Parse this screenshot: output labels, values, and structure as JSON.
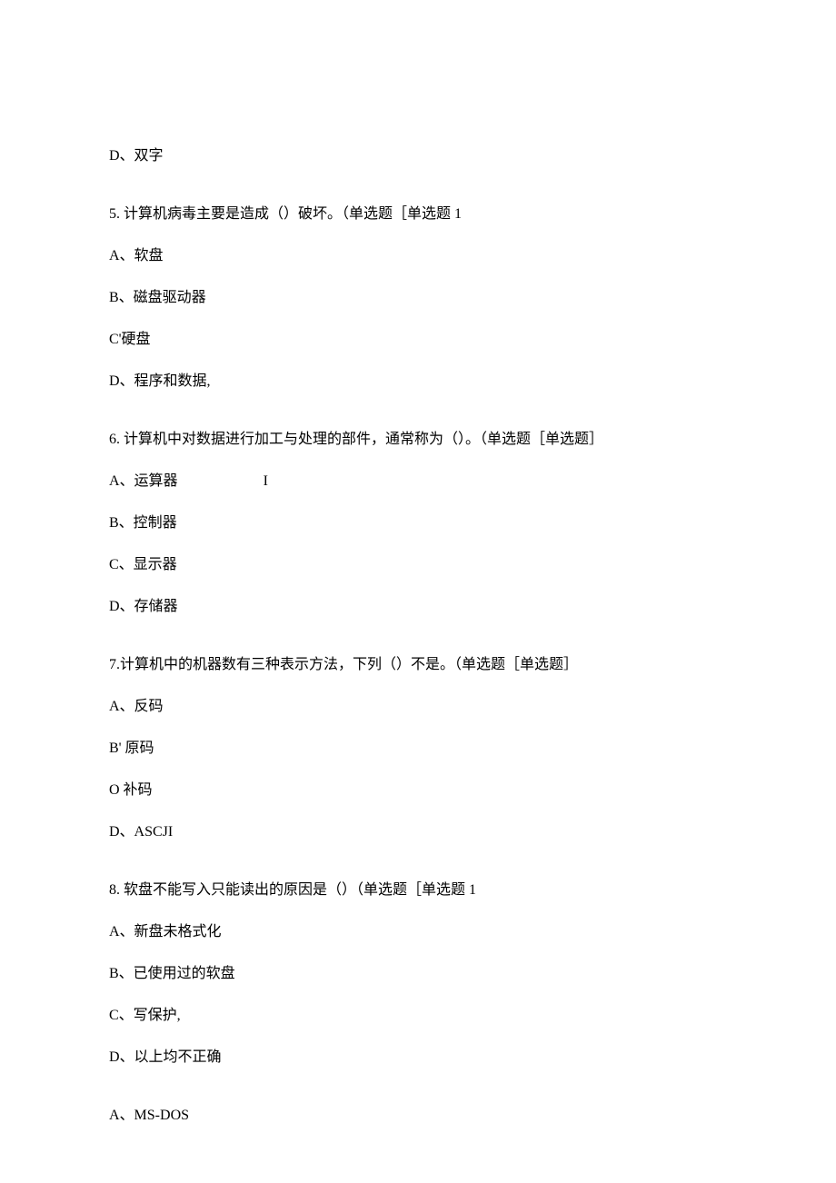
{
  "preLine": "D、双字",
  "questions": [
    {
      "prompt": "5. 计算机病毒主要是造成（）破坏。（单选题［单选题 1",
      "options": [
        "A、软盘",
        "B、磁盘驱动器",
        "C'硬盘",
        "D、程序和数据,"
      ]
    },
    {
      "prompt": "6. 计算机中对数据进行加工与处理的部件，通常称为（）。（单选题［单选题］",
      "optA": "A、运算器",
      "optAExtra": "I",
      "options": [
        "B、控制器",
        "C、显示器",
        "D、存储器"
      ]
    },
    {
      "prompt": "7.计算机中的机器数有三种表示方法，下列（）不是。（单选题［单选题］",
      "options": [
        "A、反码",
        "B' 原码",
        "O 补码",
        "D、ASCJI"
      ]
    },
    {
      "prompt": "8. 软盘不能写入只能读出的原因是（）（单选题［单选题 1",
      "options": [
        "A、新盘未格式化",
        "B、已使用过的软盘",
        "C、写保护,",
        "D、以上均不正确"
      ]
    }
  ],
  "trailingLine": "A、MS-DOS"
}
